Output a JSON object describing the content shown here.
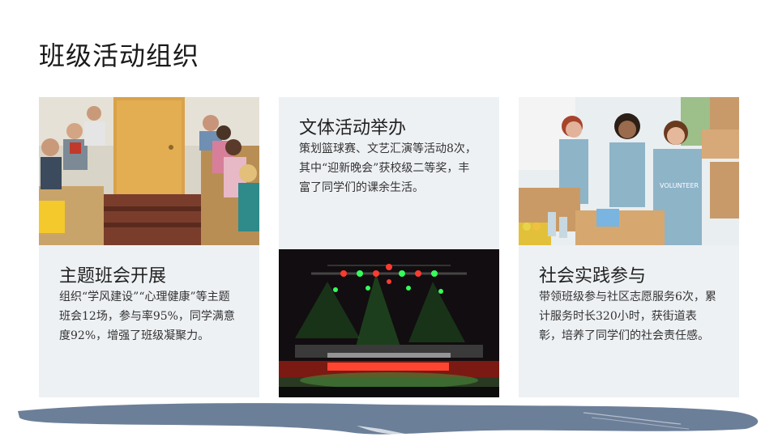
{
  "title": "班级活动组织",
  "cards": [
    {
      "heading": "主题班会开展",
      "text": "组织“学风建设”“心理健康”等主题班会12场，参与率95%，同学满意度92%，增强了班级凝聚力。"
    },
    {
      "heading": "文体活动举办",
      "text": "策划篮球赛、文艺汇演等活动8次，其中“迎新晚会”获校级二等奖，丰富了同学们的课余生活。"
    },
    {
      "heading": "社会实践参与",
      "text": "带领班级参与社区志愿服务6次，累计服务时长320小时，获街道表彰，培养了同学们的社会责任感。"
    }
  ],
  "photos": {
    "classroom": "classroom-students-photo",
    "stage": "concert-stage-lights-photo",
    "volunteers": "volunteers-packing-boxes-photo",
    "volunteer_shirt_text": "VOLUNTEER"
  },
  "colors": {
    "card_bg": "#eef1f4",
    "brush": "#6c7f99"
  }
}
